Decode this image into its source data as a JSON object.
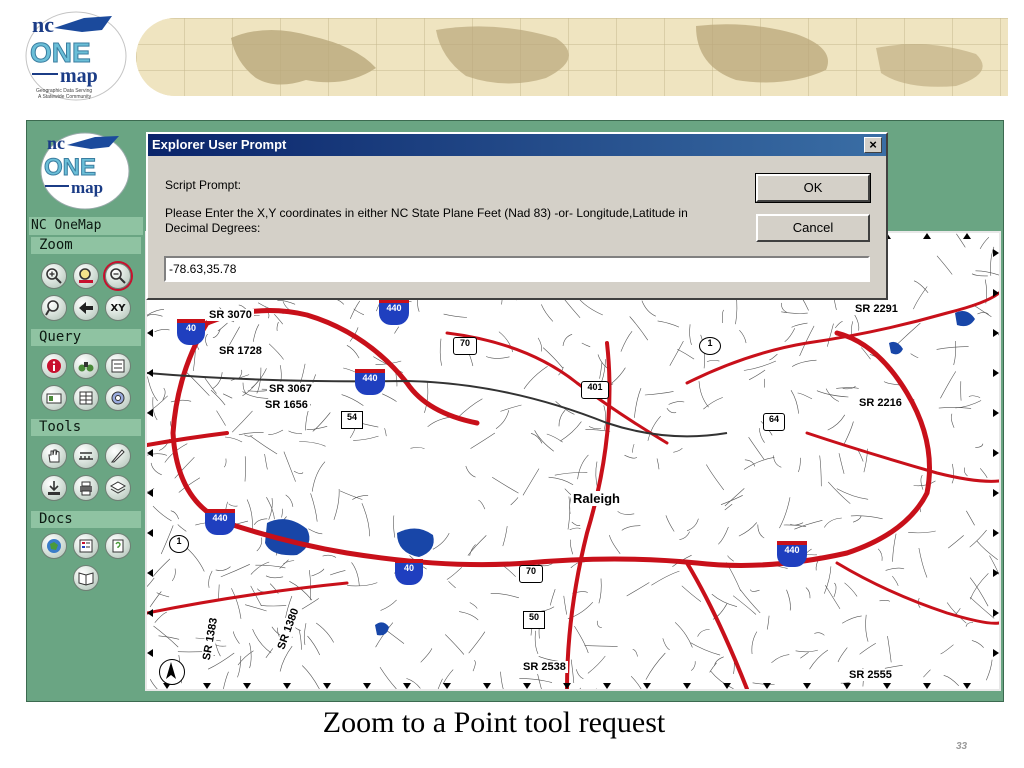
{
  "slide": {
    "logo": {
      "line1": "nc",
      "line2": "ONE",
      "line3": "map",
      "tagline1": "Geographic Data Serving",
      "tagline2": "A Statewide Community"
    },
    "caption": "Zoom to a Point tool request",
    "page_number": "33"
  },
  "sidebar": {
    "logo": {
      "line1": "nc",
      "line2": "ONE",
      "line3": "map"
    },
    "brand": "NC OneMap",
    "sections": {
      "zoom": "Zoom",
      "query": "Query",
      "tools": "Tools",
      "docs": "Docs"
    },
    "zoom_tools": [
      "zoom-in-icon",
      "zoom-extent-icon",
      "zoom-out-icon",
      "zoom-previous-icon",
      "back-arrow-icon",
      "xy-icon"
    ],
    "xy_label": "XY",
    "query_tools": [
      "identify-icon",
      "find-icon",
      "query-builder-icon",
      "select-icon",
      "table-icon",
      "buffer-icon"
    ],
    "tools_tools": [
      "pan-icon",
      "measure-icon",
      "clear-icon",
      "download-icon",
      "print-icon",
      "layers-icon"
    ],
    "docs_tools": [
      "metadata-icon",
      "legend-icon",
      "help-icon",
      "book-icon"
    ]
  },
  "map": {
    "city_label": "Raleigh",
    "north_arrow": "north-arrow-icon",
    "shields": [
      {
        "text": "40",
        "kind": "interstate"
      },
      {
        "text": "440",
        "kind": "interstate"
      },
      {
        "text": "440",
        "kind": "interstate"
      },
      {
        "text": "440",
        "kind": "interstate"
      },
      {
        "text": "40",
        "kind": "interstate"
      },
      {
        "text": "440",
        "kind": "interstate"
      },
      {
        "text": "70",
        "kind": "us"
      },
      {
        "text": "1",
        "kind": "us"
      },
      {
        "text": "401",
        "kind": "us"
      },
      {
        "text": "54",
        "kind": "state"
      },
      {
        "text": "64",
        "kind": "us"
      },
      {
        "text": "1",
        "kind": "us"
      },
      {
        "text": "70",
        "kind": "us"
      },
      {
        "text": "50",
        "kind": "state"
      }
    ],
    "road_labels": [
      "SR 3070",
      "SR 1728",
      "SR 3067",
      "SR 1656",
      "SR 2216",
      "SR 2555",
      "SR 2538",
      "SR 1383",
      "SR 1380",
      "SR 2291"
    ],
    "colors": {
      "interstate": "#1f3fbf",
      "major_road": "#c8101a",
      "water": "#1846a8"
    }
  },
  "dialog": {
    "title": "Explorer User Prompt",
    "close_label": "×",
    "prompt_title": "Script Prompt:",
    "message": "Please Enter the X,Y coordinates in either NC State Plane Feet (Nad 83) -or- Longitude,Latitude in Decimal Degrees:",
    "ok_label": "OK",
    "cancel_label": "Cancel",
    "input_value": "-78.63,35.78"
  }
}
